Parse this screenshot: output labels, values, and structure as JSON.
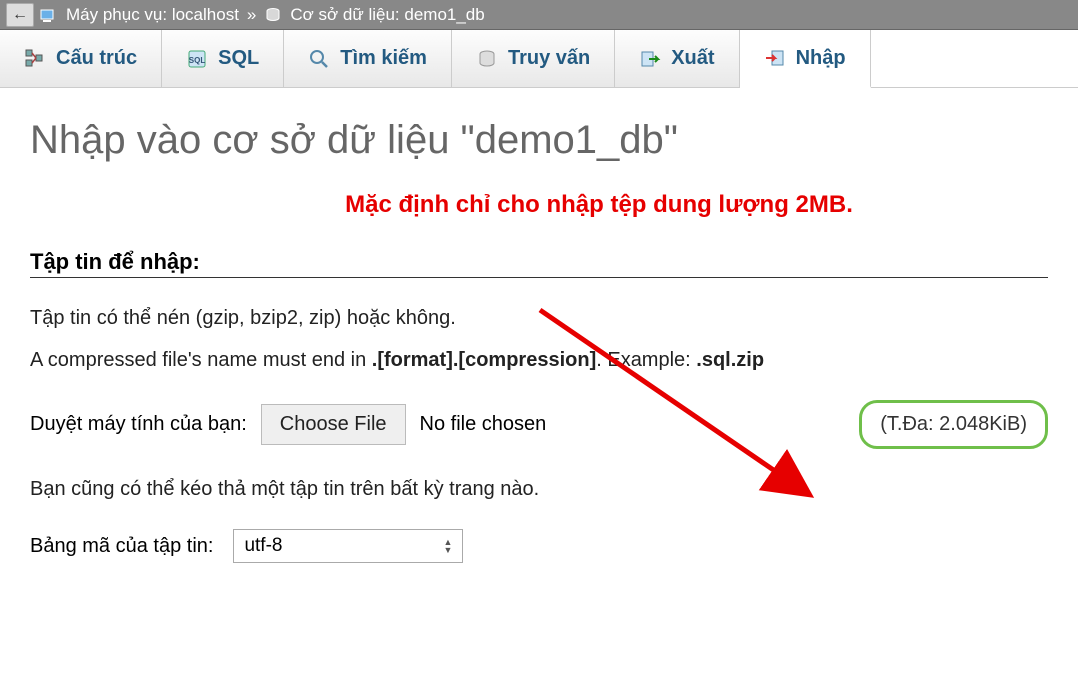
{
  "breadcrumb": {
    "server_label": "Máy phục vụ: localhost",
    "separator": "»",
    "db_label": "Cơ sở dữ liệu: demo1_db"
  },
  "tabs": [
    {
      "id": "structure",
      "label": "Cấu trúc"
    },
    {
      "id": "sql",
      "label": "SQL"
    },
    {
      "id": "search",
      "label": "Tìm kiếm"
    },
    {
      "id": "query",
      "label": "Truy vấn"
    },
    {
      "id": "export",
      "label": "Xuất"
    },
    {
      "id": "import",
      "label": "Nhập"
    }
  ],
  "page_title": "Nhập vào cơ sở dữ liệu \"demo1_db\"",
  "annotation_text": "Mặc định chỉ cho nhập tệp dung lượng 2MB.",
  "section_title": "Tập tin để nhập:",
  "compress_line": "Tập tin có thể nén (gzip, bzip2, zip) hoặc không.",
  "format_line_prefix": "A compressed file's name must end in ",
  "format_pattern": ".[format].[compression]",
  "format_example_label": ". Example: ",
  "format_example": ".sql.zip",
  "browse_label": "Duyệt máy tính của bạn:",
  "choose_file_label": "Choose File",
  "no_file_text": "No file chosen",
  "max_label": "(T.Đa: 2.048KiB)",
  "dragdrop_text": "Bạn cũng có thể kéo thả một tập tin trên bất kỳ trang nào.",
  "charset_label": "Bảng mã của tập tin:",
  "charset_value": "utf-8"
}
